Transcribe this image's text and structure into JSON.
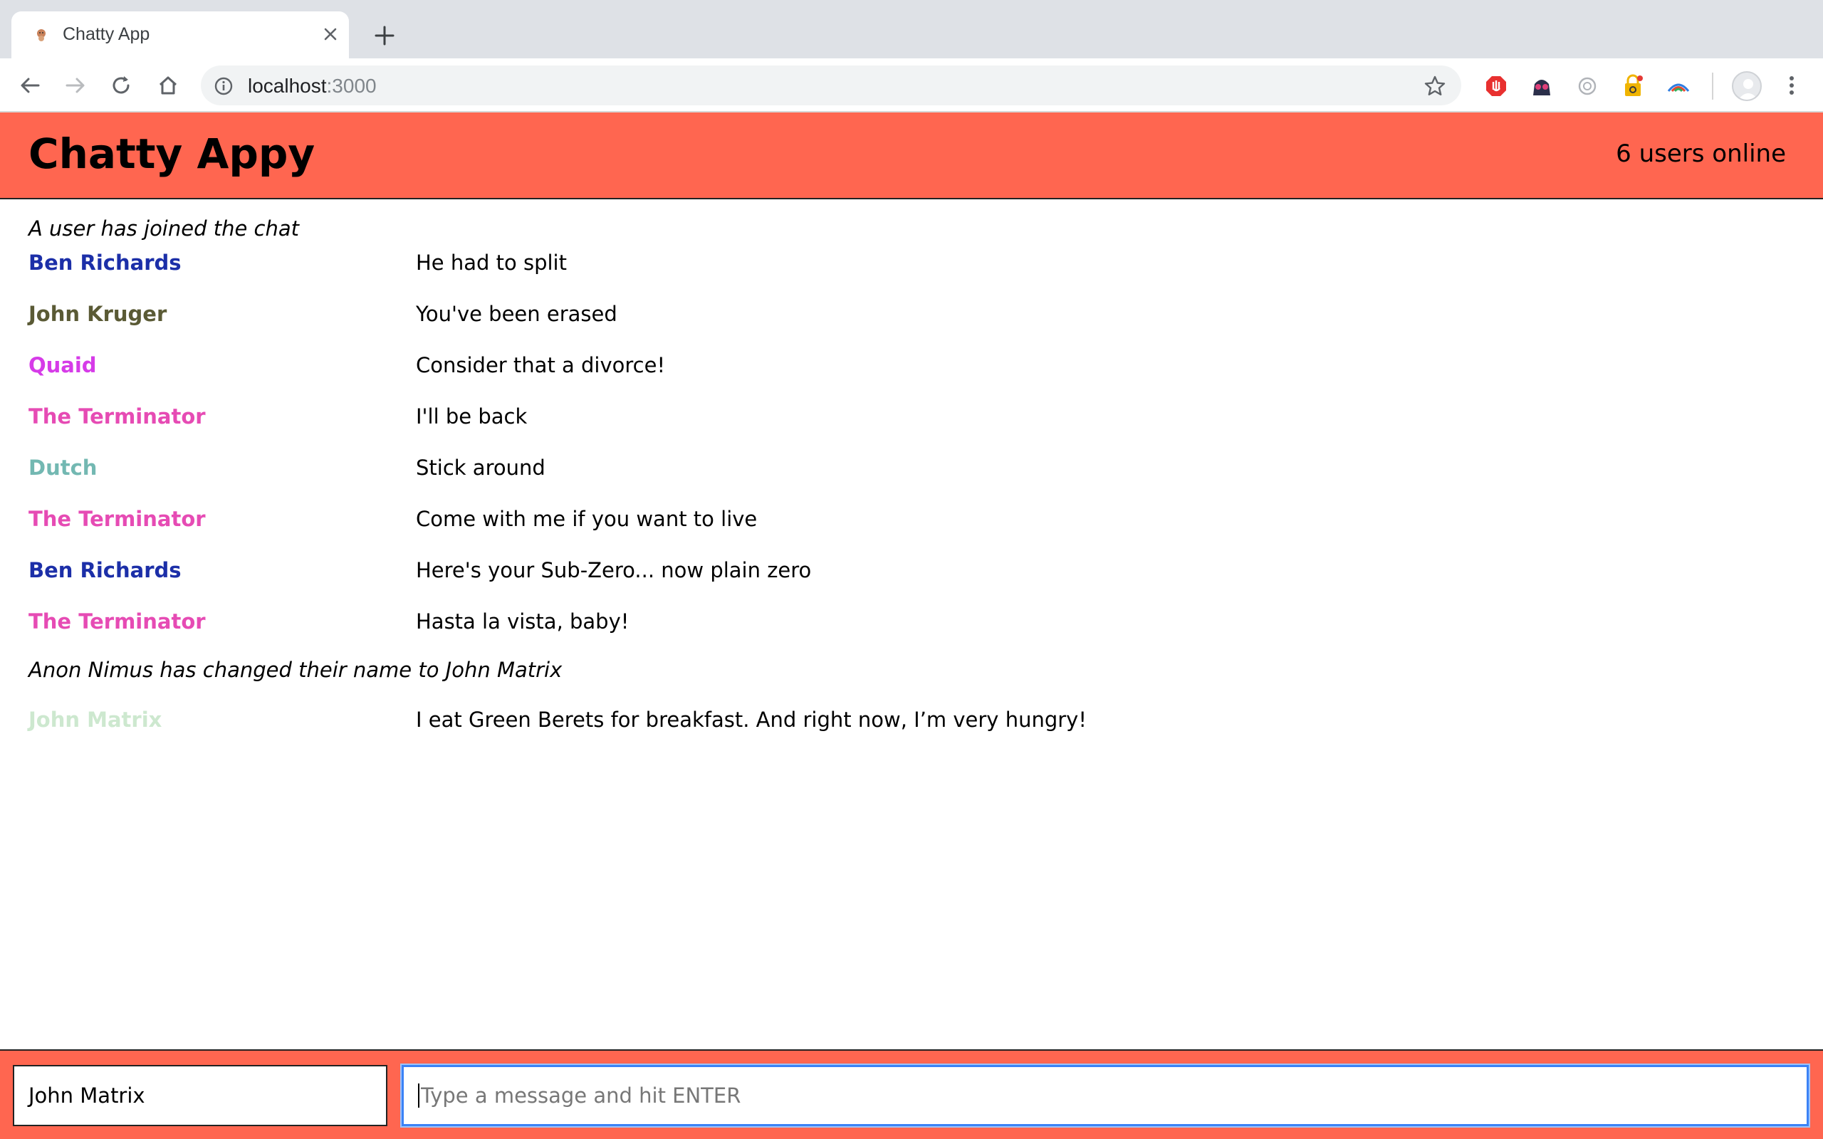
{
  "browser": {
    "tab_title": "Chatty App",
    "url_host": "localhost",
    "url_port": ":3000"
  },
  "app": {
    "title": "Chatty Appy",
    "users_online": "6 users online"
  },
  "messages": [
    {
      "type": "notification",
      "text": "A user has joined the chat"
    },
    {
      "type": "message",
      "username": "Ben Richards",
      "color": "#1c2fa8",
      "content": "He had to split"
    },
    {
      "type": "message",
      "username": "John Kruger",
      "color": "#5a5a35",
      "content": "You've been erased"
    },
    {
      "type": "message",
      "username": "Quaid",
      "color": "#d63be8",
      "content": "Consider that a divorce!"
    },
    {
      "type": "message",
      "username": "The Terminator",
      "color": "#e64bb4",
      "content": "I'll be back"
    },
    {
      "type": "message",
      "username": "Dutch",
      "color": "#73b8b2",
      "content": "Stick around"
    },
    {
      "type": "message",
      "username": "The Terminator",
      "color": "#e64bb4",
      "content": "Come with me if you want to live"
    },
    {
      "type": "message",
      "username": "Ben Richards",
      "color": "#1c2fa8",
      "content": "Here's your Sub-Zero... now plain zero"
    },
    {
      "type": "message",
      "username": "The Terminator",
      "color": "#e64bb4",
      "content": "Hasta la vista, baby!"
    },
    {
      "type": "notification",
      "text": "Anon Nimus has changed their name to John Matrix"
    },
    {
      "type": "message",
      "username": "John Matrix",
      "color": "#cde8cf",
      "content": "I eat Green Berets for breakfast. And right now, I’m very hungry!"
    }
  ],
  "composer": {
    "username_value": "John Matrix",
    "message_placeholder": "Type a message and hit ENTER"
  },
  "colors": {
    "brand": "#ff6650",
    "focus_ring": "#3b82f6"
  }
}
